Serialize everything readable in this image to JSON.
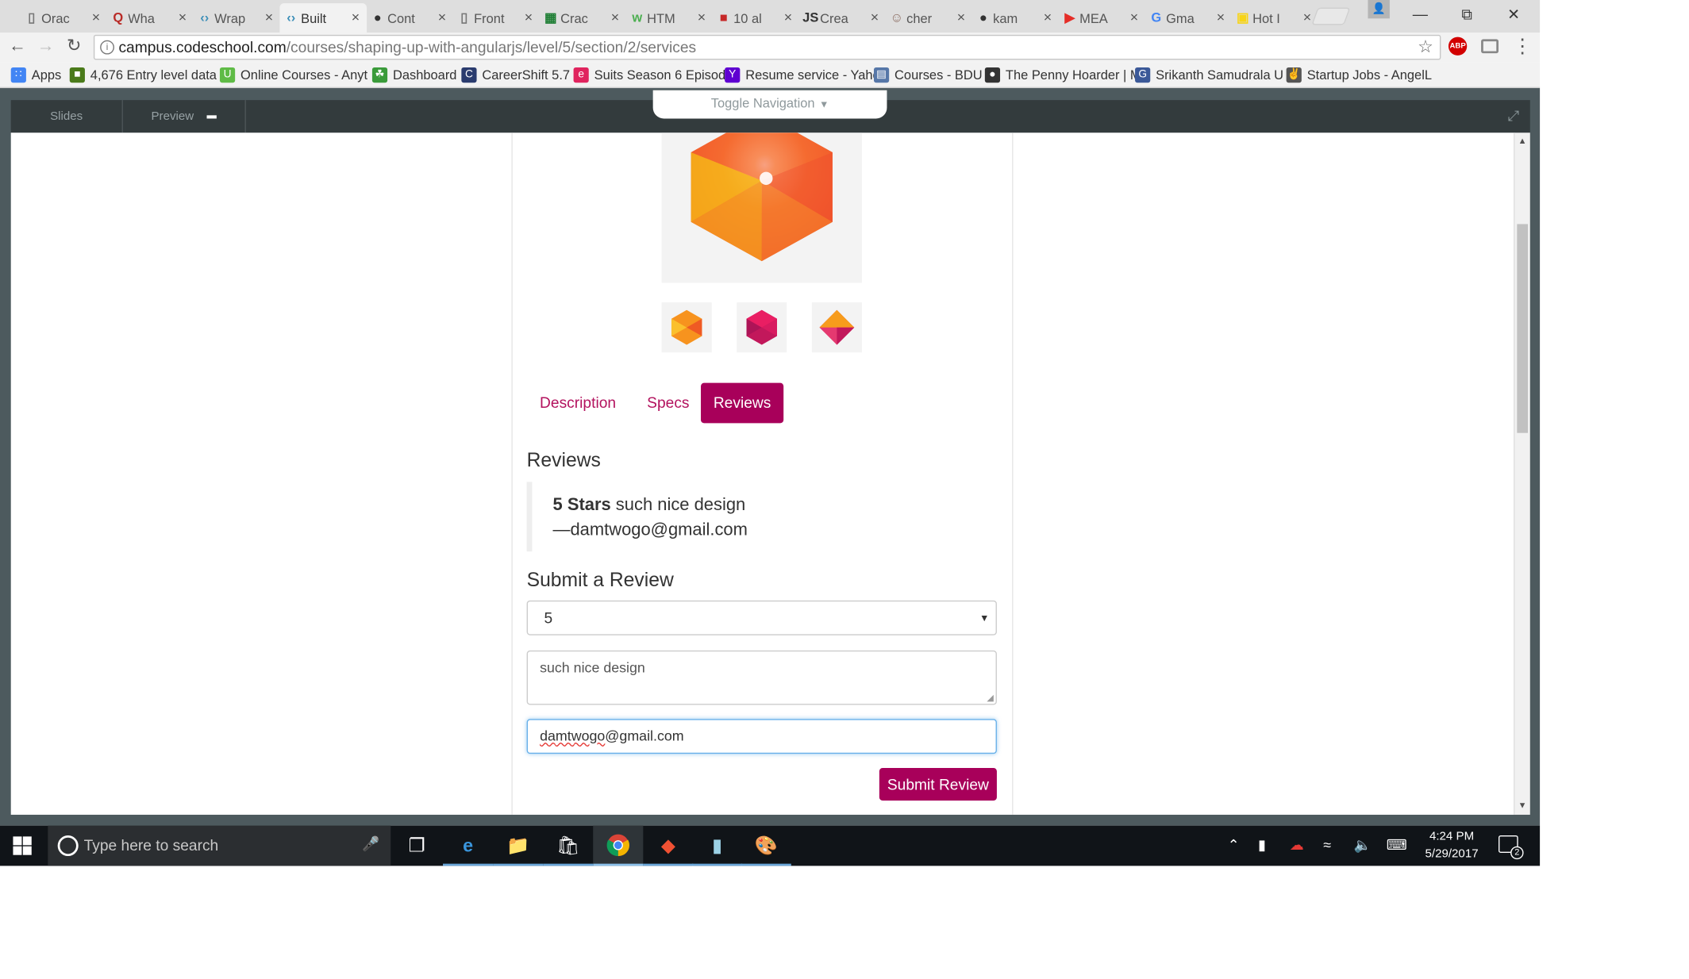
{
  "browser": {
    "tabs": [
      {
        "label": "Orac",
        "icon": "document-icon",
        "icon_color": "#777777"
      },
      {
        "label": "Wha",
        "icon": "quora-icon",
        "icon_color": "#b92b27"
      },
      {
        "label": "Wrap",
        "icon": "code-icon",
        "icon_color": "#3d8fb8"
      },
      {
        "label": "Built",
        "icon": "code-icon",
        "icon_color": "#3d8fb8"
      },
      {
        "label": "Cont",
        "icon": "github-icon",
        "icon_color": "#333333"
      },
      {
        "label": "Front",
        "icon": "document-icon",
        "icon_color": "#777777"
      },
      {
        "label": "Crac",
        "icon": "spreadsheet-icon",
        "icon_color": "#1e7e34"
      },
      {
        "label": "HTM",
        "icon": "w3schools-icon",
        "icon_color": "#4caf50"
      },
      {
        "label": "10 al",
        "icon": "media-icon",
        "icon_color": "#c62828"
      },
      {
        "label": "Crea",
        "icon": "js-icon",
        "icon_color": "#333333"
      },
      {
        "label": "cher",
        "icon": "avatar-icon",
        "icon_color": "#8d6e63"
      },
      {
        "label": "kam",
        "icon": "github-icon",
        "icon_color": "#333333"
      },
      {
        "label": "MEA",
        "icon": "youtube-icon",
        "icon_color": "#e52d27"
      },
      {
        "label": "Gma",
        "icon": "google-icon",
        "icon_color": "#4285f4"
      },
      {
        "label": "Hot I",
        "icon": "bestbuy-icon",
        "icon_color": "#f7d417"
      }
    ],
    "url_host": "campus.codeschool.com",
    "url_path": "/courses/shaping-up-with-angularjs/level/5/section/2/services",
    "bookmarks": [
      {
        "label": "Apps",
        "icon": "apps-grid-icon",
        "color": "#4285f4"
      },
      {
        "label": "4,676 Entry level data",
        "icon": "bookmark-green-icon",
        "color": "#4a7a1a"
      },
      {
        "label": "Online Courses - Anyt",
        "icon": "udemy-icon",
        "color": "#5fbb46"
      },
      {
        "label": "Dashboard",
        "icon": "leaf-icon",
        "color": "#3a9b3a"
      },
      {
        "label": "CareerShift 5.7",
        "icon": "careershift-icon",
        "color": "#2a3b6e"
      },
      {
        "label": "Suits Season 6 Episod",
        "icon": "episode-icon",
        "color": "#e0245e"
      },
      {
        "label": "Resume service - Yaho",
        "icon": "yahoo-icon",
        "color": "#5f01d1"
      },
      {
        "label": "Courses - BDU",
        "icon": "school-icon",
        "color": "#5677a8"
      },
      {
        "label": "The Penny Hoarder | M",
        "icon": "penny-icon",
        "color": "#333333"
      },
      {
        "label": "Srikanth Samudrala U",
        "icon": "g-icon",
        "color": "#3b5998"
      },
      {
        "label": "Startup Jobs - AngelL",
        "icon": "angellist-icon",
        "color": "#555555"
      }
    ]
  },
  "course": {
    "toolbar": {
      "slides": "Slides",
      "preview": "Preview"
    },
    "toggle_nav": "Toggle Navigation",
    "tabs": [
      {
        "label": "Description",
        "active": false
      },
      {
        "label": "Specs",
        "active": false
      },
      {
        "label": "Reviews",
        "active": true
      }
    ],
    "reviews_heading": "Reviews",
    "review": {
      "stars": "5 Stars",
      "body": "such nice design",
      "author": "—damtwogo@gmail.com"
    },
    "submit_heading": "Submit a Review",
    "form": {
      "rating_value": "5",
      "body_value": "such nice design",
      "author_value_misspelled": "damtwogo",
      "author_value_rest": "@gmail.com",
      "submit_label": "Submit Review"
    },
    "accent": "#a8005a"
  },
  "taskbar": {
    "search_placeholder": "Type here to search",
    "time": "4:24 PM",
    "date": "5/29/2017",
    "notifications": "2"
  }
}
